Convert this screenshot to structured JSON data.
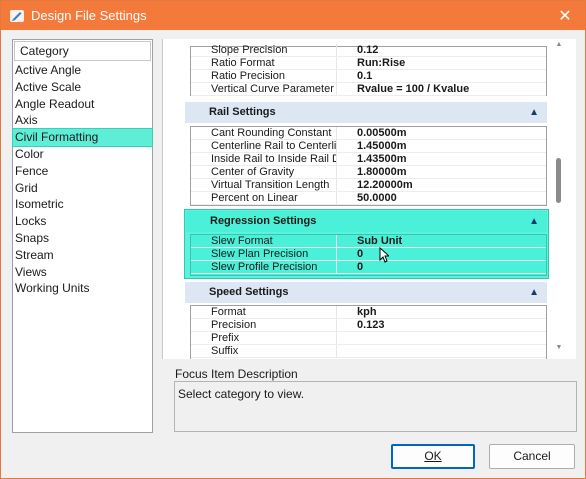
{
  "window": {
    "title": "Design File Settings",
    "close_glyph": "✕",
    "accent": "#f47a3c",
    "highlight": "#5eeed8"
  },
  "category": {
    "header": "Category",
    "items": [
      "Active Angle",
      "Active Scale",
      "Angle Readout",
      "Axis",
      "Civil Formatting",
      "Color",
      "Fence",
      "Grid",
      "Isometric",
      "Locks",
      "Snaps",
      "Stream",
      "Views",
      "Working Units"
    ],
    "selected": "Civil Formatting"
  },
  "top_rows": [
    {
      "k": "Slope Precision",
      "v": "0.12"
    },
    {
      "k": "Ratio Format",
      "v": "Run:Rise"
    },
    {
      "k": "Ratio Precision",
      "v": "0.1"
    },
    {
      "k": "Vertical Curve Parameter Format",
      "v": "Rvalue = 100 / Kvalue"
    }
  ],
  "rail": {
    "title": "Rail Settings",
    "rows": [
      {
        "k": "Cant Rounding Constant",
        "v": "0.00500m"
      },
      {
        "k": "Centerline Rail to Centerline Rail D",
        "v": "1.45000m"
      },
      {
        "k": "Inside Rail to Inside Rail Distance",
        "v": "1.43500m"
      },
      {
        "k": "Center of Gravity",
        "v": "1.80000m"
      },
      {
        "k": "Virtual Transition Length",
        "v": "12.20000m"
      },
      {
        "k": "Percent on Linear",
        "v": "50.0000"
      }
    ]
  },
  "regression": {
    "title": "Regression Settings",
    "rows": [
      {
        "k": "Slew Format",
        "v": "Sub Unit"
      },
      {
        "k": "Slew Plan Precision",
        "v": "0"
      },
      {
        "k": "Slew Profile Precision",
        "v": "0"
      }
    ]
  },
  "speed": {
    "title": "Speed Settings",
    "rows": [
      {
        "k": "Format",
        "v": "kph"
      },
      {
        "k": "Precision",
        "v": "0.123"
      },
      {
        "k": "Prefix",
        "v": ""
      },
      {
        "k": "Suffix",
        "v": ""
      }
    ]
  },
  "focus": {
    "label": "Focus Item Description",
    "text": "Select category to view."
  },
  "buttons": {
    "ok": "OK",
    "cancel": "Cancel"
  }
}
